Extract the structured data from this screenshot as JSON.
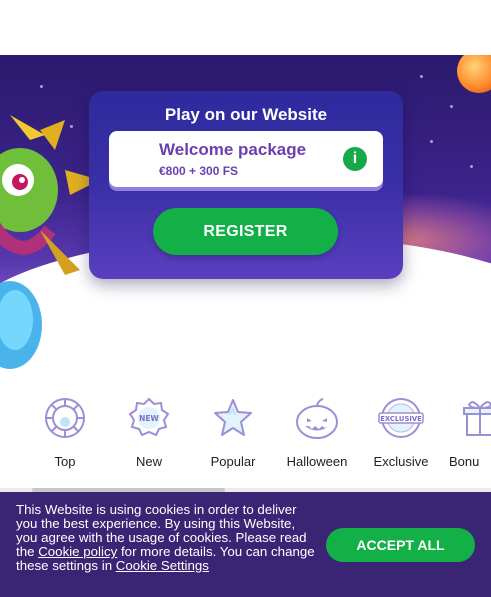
{
  "hero": {
    "card_title": "Play on our Website",
    "package_name": "Welcome package",
    "package_offer": "€800 + 300 FS",
    "info_icon": "info-icon",
    "register_label": "REGISTER"
  },
  "categories": [
    {
      "label": "Top",
      "icon": "chip-icon"
    },
    {
      "label": "New",
      "icon": "new-badge-icon"
    },
    {
      "label": "Popular",
      "icon": "star-icon"
    },
    {
      "label": "Halloween",
      "icon": "pumpkin-icon"
    },
    {
      "label": "Exclusive",
      "icon": "exclusive-badge-icon"
    },
    {
      "label": "Bonu",
      "icon": "gift-icon"
    }
  ],
  "cookie": {
    "text_1": "This Website is using cookies in order to deliver you the best experience. By using this Website, you agree with the usage of cookies. Please read the ",
    "link_policy": "Cookie policy",
    "text_2": " for more details. You can change these settings in ",
    "link_settings": "Cookie Settings",
    "accept_label": "ACCEPT ALL"
  },
  "colors": {
    "accent_green": "#12b046",
    "brand_purple": "#3a2474",
    "package_text": "#6b3fb0"
  }
}
